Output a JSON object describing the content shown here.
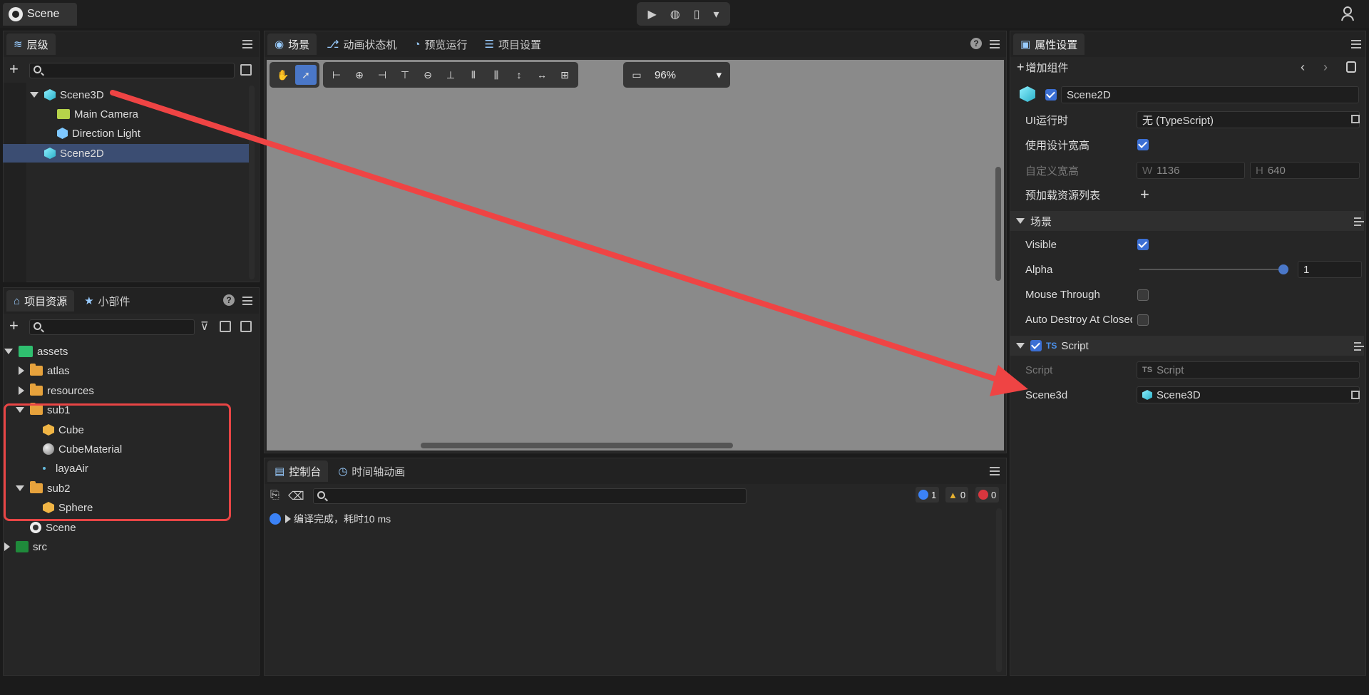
{
  "topbar": {
    "scene_tab": "Scene"
  },
  "hierarchy": {
    "tab": "层级",
    "items": [
      "Scene3D",
      "Main Camera",
      "Direction Light",
      "Scene2D"
    ]
  },
  "scene_panel": {
    "tabs": [
      "场景",
      "动画状态机",
      "预览运行",
      "项目设置"
    ],
    "zoom": "96%"
  },
  "properties": {
    "tab": "属性设置",
    "add_component": "增加组件",
    "node_name": "Scene2D",
    "rows": {
      "ui_runtime_label": "UI运行时",
      "ui_runtime_value": "无 (TypeScript)",
      "use_design_label": "使用设计宽高",
      "custom_size_label": "自定义宽高",
      "w_label": "W",
      "w_value": "1136",
      "h_label": "H",
      "h_value": "640",
      "preload_label": "预加载资源列表"
    },
    "scene_section": "场景",
    "visible_label": "Visible",
    "alpha_label": "Alpha",
    "alpha_value": "1",
    "mouse_through_label": "Mouse Through",
    "auto_destroy_label": "Auto Destroy At Closed",
    "script_section": "Script",
    "script_label": "Script",
    "script_value": "Script",
    "scene3d_label": "Scene3d",
    "scene3d_value": "Scene3D"
  },
  "assets": {
    "tabs": [
      "项目资源",
      "小部件"
    ],
    "items": [
      "assets",
      "atlas",
      "resources",
      "sub1",
      "Cube",
      "CubeMaterial",
      "layaAir",
      "sub2",
      "Sphere",
      "Scene",
      "src"
    ]
  },
  "console": {
    "tabs": [
      "控制台",
      "时间轴动画"
    ],
    "info_count": "1",
    "warn_count": "0",
    "error_count": "0",
    "message": "编译完成，耗时10 ms"
  },
  "colors": {
    "accent": "#4a77c8",
    "highlight": "#e84545",
    "viewport": "#8a8a8a"
  }
}
